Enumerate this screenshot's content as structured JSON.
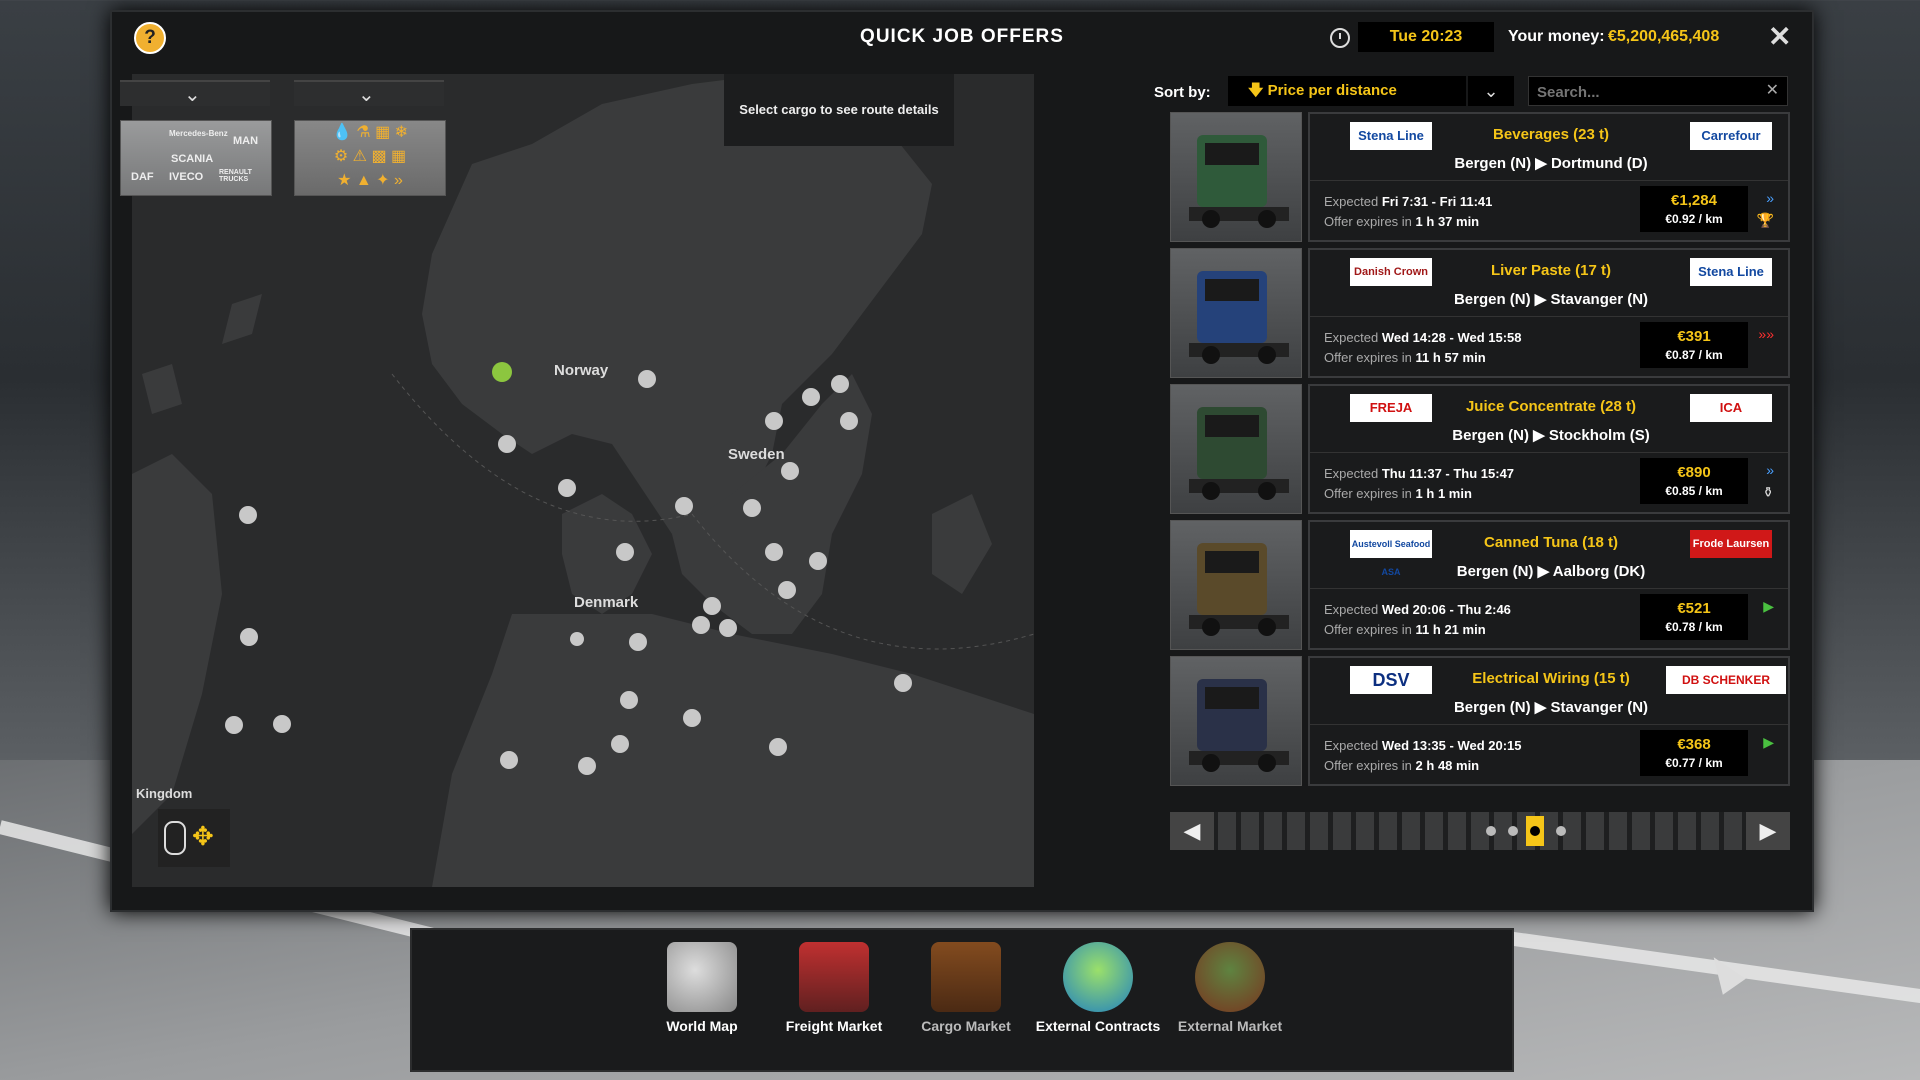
{
  "window": {
    "title": "QUICK JOB OFFERS",
    "help_label": "?",
    "clock_time": "Tue 20:23",
    "money_label": "Your money:",
    "money_value": "€5,200,465,408",
    "close_label": "✕"
  },
  "map": {
    "route_hint": "Select cargo to see route details",
    "labels": {
      "norway": "Norway",
      "sweden": "Sweden",
      "denmark": "Denmark",
      "kingdom": "Kingdom"
    },
    "brands_text": {
      "row1": "Mercedes-Benz",
      "row2": "SCANIA",
      "row3a": "DAF",
      "row3b": "IVECO",
      "row3c": "RENAULT TRUCKS",
      "man": "MAN"
    }
  },
  "sort": {
    "label": "Sort by:",
    "selected": "Price per distance",
    "search_placeholder": "Search..."
  },
  "offers": [
    {
      "cargo": "Beverages (23 t)",
      "origin": "Bergen (N)",
      "destination": "Dortmund (D)",
      "logo_left": "Stena Line",
      "logo_right": "Carrefour",
      "expected_label": "Expected",
      "expected": "Fri 7:31 - Fri 11:41",
      "expires_label": "Offer expires in",
      "expires": "1 h 37 min",
      "price": "€1,284",
      "per_km": "€0.92 / km",
      "icon1": "»",
      "icon2": "🏆",
      "truck_color": "#2f5a3a"
    },
    {
      "cargo": "Liver Paste (17 t)",
      "origin": "Bergen (N)",
      "destination": "Stavanger (N)",
      "logo_left": "Danish Crown",
      "logo_right": "Stena Line",
      "expected_label": "Expected",
      "expected": "Wed 14:28 - Wed 15:58",
      "expires_label": "Offer expires in",
      "expires": "11 h 57 min",
      "price": "€391",
      "per_km": "€0.87 / km",
      "icon1": "»»",
      "icon2": "",
      "truck_color": "#25427a"
    },
    {
      "cargo": "Juice Concentrate (28 t)",
      "origin": "Bergen (N)",
      "destination": "Stockholm (S)",
      "logo_left": "FREJA",
      "logo_right": "ICA",
      "expected_label": "Expected",
      "expected": "Thu 11:37 - Thu 15:47",
      "expires_label": "Offer expires in",
      "expires": "1 h 1 min",
      "price": "€890",
      "per_km": "€0.85 / km",
      "icon1": "»",
      "icon2": "⚱",
      "truck_color": "#2e4a32"
    },
    {
      "cargo": "Canned Tuna (18 t)",
      "origin": "Bergen (N)",
      "destination": "Aalborg (DK)",
      "logo_left": "Austevoll Seafood ASA",
      "logo_right": "Frode Laursen",
      "expected_label": "Expected",
      "expected": "Wed 20:06 - Thu 2:46",
      "expires_label": "Offer expires in",
      "expires": "11 h 21 min",
      "price": "€521",
      "per_km": "€0.78 / km",
      "icon1": "▶",
      "icon2": "",
      "truck_color": "#5a4a2a"
    },
    {
      "cargo": "Electrical Wiring (15 t)",
      "origin": "Bergen (N)",
      "destination": "Stavanger (N)",
      "logo_left": "DSV",
      "logo_right": "DB SCHENKER",
      "expected_label": "Expected",
      "expected": "Wed 13:35 - Wed 20:15",
      "expires_label": "Offer expires in",
      "expires": "2 h 48 min",
      "price": "€368",
      "per_km": "€0.77 / km",
      "icon1": "▶",
      "icon2": "",
      "truck_color": "#2a3148"
    }
  ],
  "pager": {
    "prev": "◀",
    "next": "▶"
  },
  "nav": [
    {
      "label": "World Map",
      "icon": "world-map-icon",
      "active": true
    },
    {
      "label": "Freight Market",
      "icon": "forklift-icon",
      "active": true
    },
    {
      "label": "Cargo Market",
      "icon": "cargo-icon",
      "active": false
    },
    {
      "label": "External Contracts",
      "icon": "globe-contracts-icon",
      "active": true
    },
    {
      "label": "External Market",
      "icon": "globe-market-icon",
      "active": false
    }
  ],
  "colors": {
    "accent": "#f5c518",
    "panel": "#1a1b1c"
  }
}
